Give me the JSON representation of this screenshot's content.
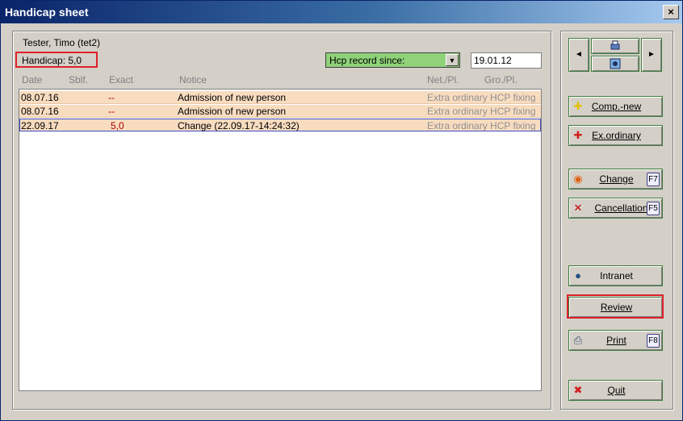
{
  "window": {
    "title": "Handicap sheet",
    "close_label": "×"
  },
  "person": {
    "name": "Tester, Timo (tet2)",
    "handicap": "Handicap: 5,0"
  },
  "filter": {
    "dropdown_value": "Hcp record since:",
    "date_value": "19.01.12"
  },
  "columns": [
    "Date",
    "Sblf.",
    "Exact",
    "Notice",
    "Net./Pl.",
    "Gro./Pl."
  ],
  "rows": [
    {
      "date": "08.07.16",
      "sblf": "",
      "exact": "--",
      "notice": "Admission of new person",
      "netpl": "Extra ordinary HCP fixing",
      "selected": false
    },
    {
      "date": "08.07.16",
      "sblf": "",
      "exact": "--",
      "notice": "Admission of new person",
      "netpl": "Extra ordinary HCP fixing",
      "selected": false
    },
    {
      "date": "22.09.17",
      "sblf": "",
      "exact": "5,0",
      "notice": "Change (22.09.17-14:24:32)",
      "netpl": "Extra ordinary HCP fixing",
      "selected": true
    }
  ],
  "buttons": {
    "comp_new": "Comp.-new",
    "exordinary": "Ex.ordinary",
    "change": "Change",
    "change_key": "F7",
    "cancellation": "Cancellation",
    "cancellation_key": "F5",
    "intranet": "Intranet",
    "review": "Review",
    "print": "Print",
    "print_key": "F8",
    "quit": "Quit"
  },
  "nav": {
    "left": "◄",
    "right": "►"
  },
  "colors": {
    "row_bg": "#f8dcc0",
    "highlight": "#e0202a",
    "dropdown_bg": "#8fd27a"
  }
}
